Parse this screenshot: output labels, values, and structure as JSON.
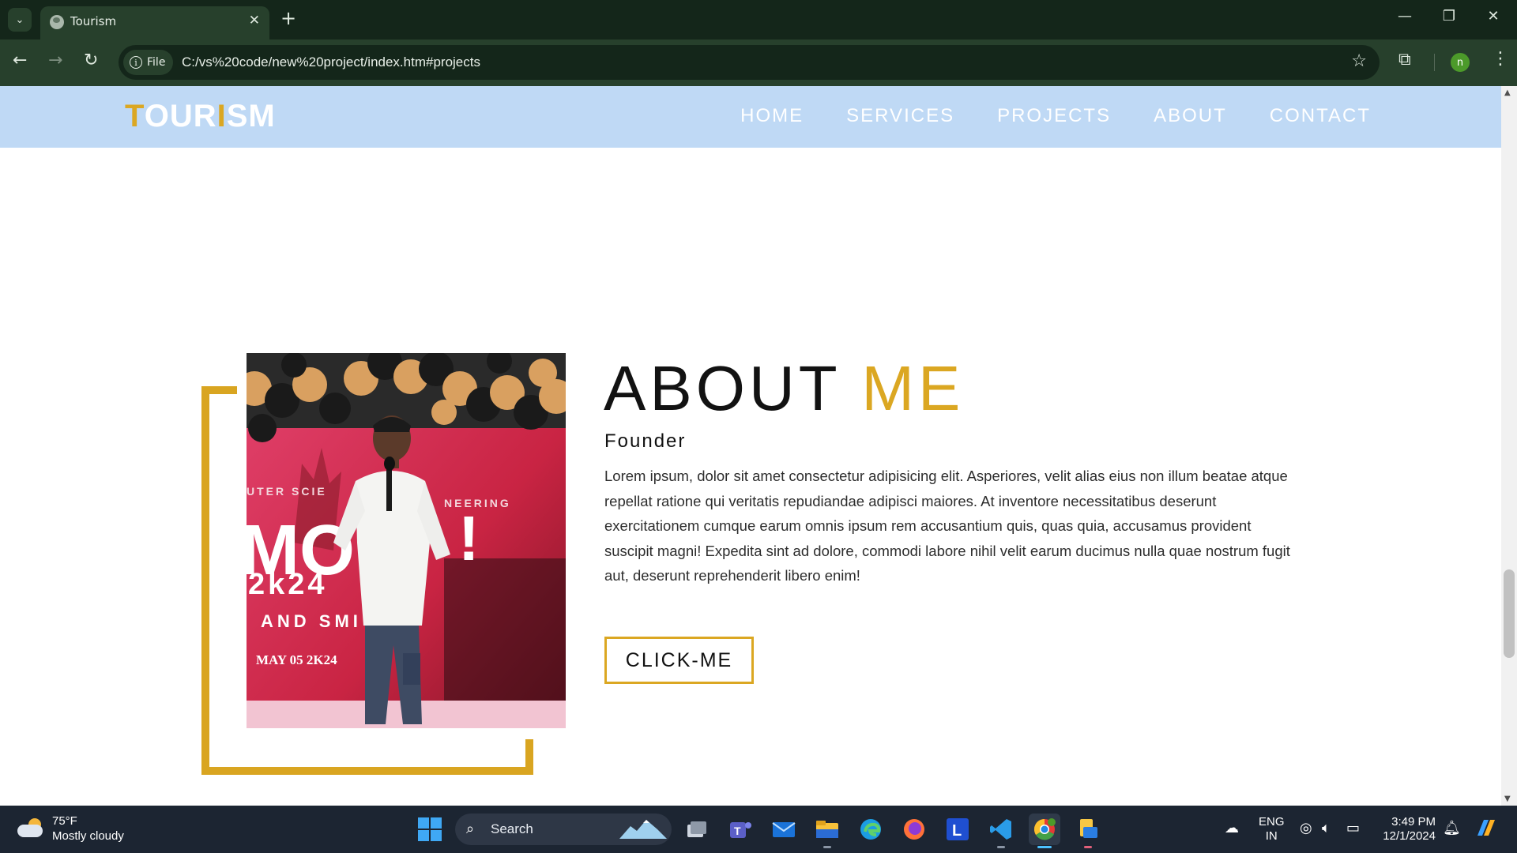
{
  "browser": {
    "tab_title": "Tourism",
    "tab_close": "✕",
    "new_tab": "+",
    "window_controls": {
      "minimize": "—",
      "restore": "❐",
      "close": "✕"
    },
    "site_info_label": "File",
    "url": "C:/vs%20code/new%20project/index.htm#projects",
    "profile_initial": "n"
  },
  "site": {
    "logo": {
      "part1": "T",
      "part2": "OUR",
      "part3": "I",
      "part4": "SM"
    },
    "nav": [
      "HOME",
      "SERVICES",
      "PROJECTS",
      "ABOUT",
      "CONTACT"
    ],
    "about": {
      "title_main": "ABOUT",
      "title_accent": "ME",
      "subtitle": "Founder",
      "paragraph": "Lorem ipsum, dolor sit amet consectetur adipisicing elit. Asperiores, velit alias eius non illum beatae atque repellat ratione qui veritatis repudiandae adipisci maiores. At inventore necessitatibus deserunt exercitationem cumque earum omnis ipsum rem accusantium quis, quas quia, accusamus provident suscipit magni! Expedita sint ad dolore, commodi labore nihil velit earum ducimus nulla quae nostrum fugit aut, deserunt reprehenderit libero enim!",
      "button": "CLICK-ME",
      "photo_text": {
        "line1": "UTER SCIE",
        "line1b": "NEERING",
        "big": "MO",
        "big2": "!",
        "year": "2k24",
        "line3": "AND SMI",
        "date": "MAY 05 2K24"
      }
    },
    "accent_color": "#dba722",
    "header_color": "#bfd9f5"
  },
  "taskbar": {
    "weather_temp": "75°F",
    "weather_desc": "Mostly cloudy",
    "search_label": "Search",
    "apps": [
      "task-view",
      "teams",
      "mail",
      "file-explorer",
      "edge",
      "firefox",
      "l-app",
      "vscode",
      "chrome",
      "files"
    ],
    "language": "ENG",
    "region": "IN",
    "time": "3:49 PM",
    "date": "12/1/2024"
  }
}
